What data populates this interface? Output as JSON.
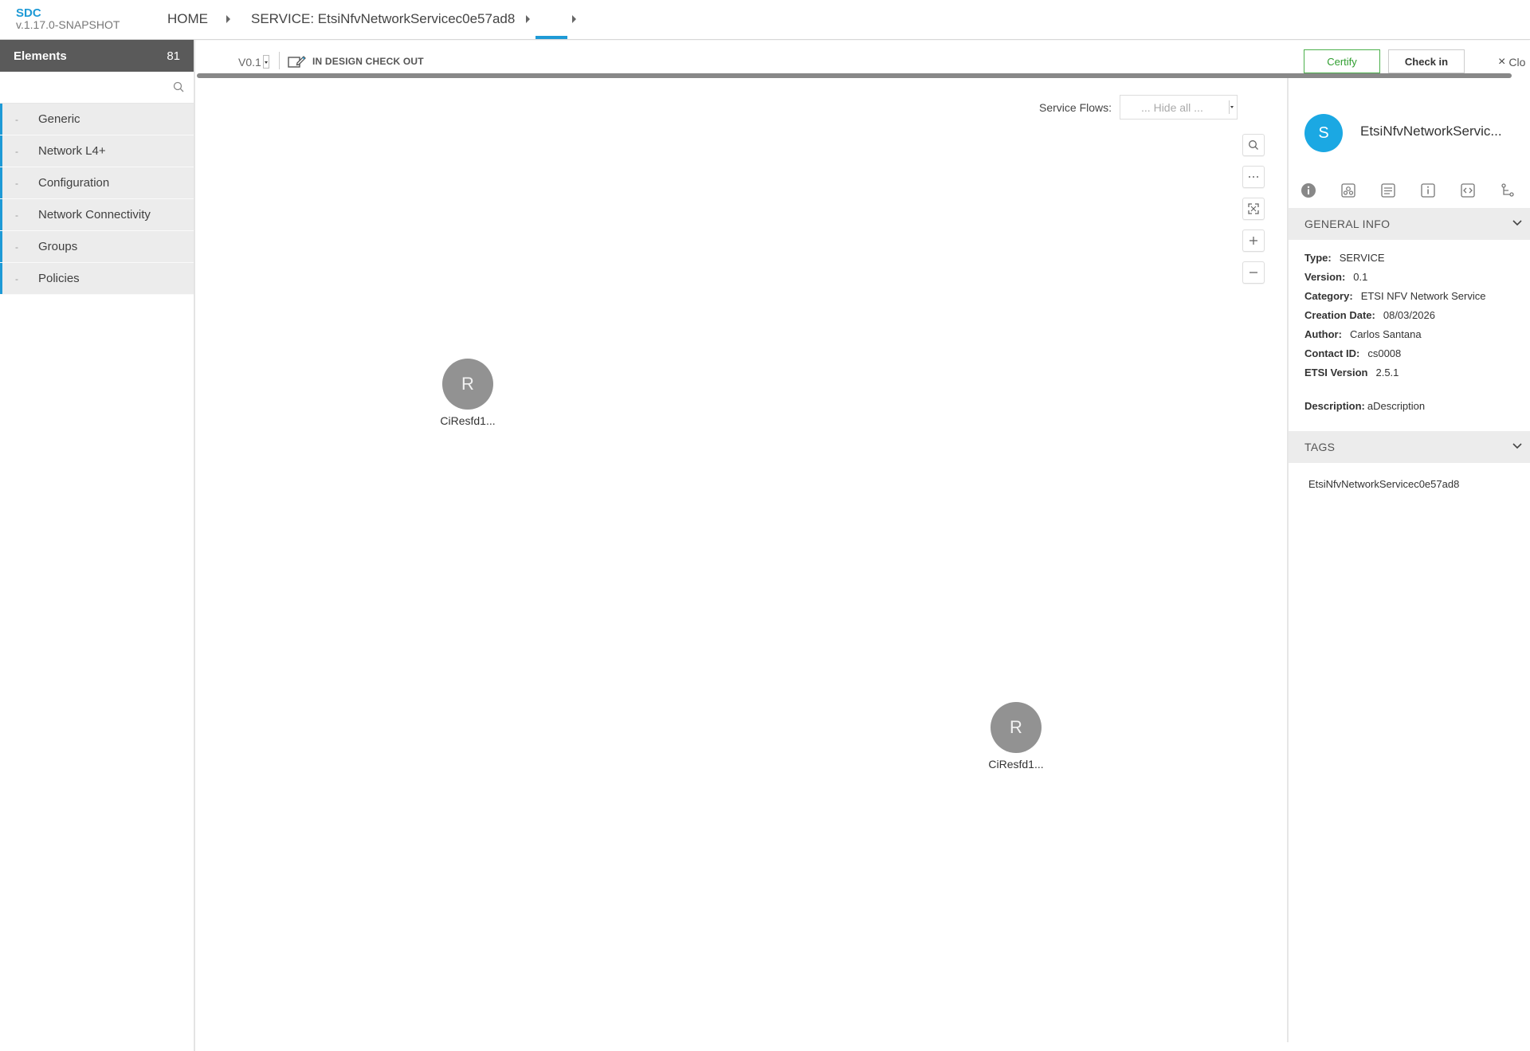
{
  "app": {
    "name": "SDC",
    "version": "v.1.17.0-SNAPSHOT"
  },
  "breadcrumb": {
    "home": "HOME",
    "service": "SERVICE: EtsiNfvNetworkServicec0e57ad8"
  },
  "palette": {
    "header_label": "Elements",
    "header_count": "81",
    "search_placeholder": "",
    "items": [
      {
        "label": "Generic"
      },
      {
        "label": "Network L4+"
      },
      {
        "label": "Configuration"
      },
      {
        "label": "Network Connectivity"
      },
      {
        "label": "Groups"
      },
      {
        "label": "Policies"
      }
    ]
  },
  "toolbar": {
    "version": "V0.1",
    "status": "IN DESIGN CHECK OUT",
    "certify_label": "Certify",
    "checkin_label": "Check in",
    "close_label": "Clo"
  },
  "canvas": {
    "service_flows_label": "Service Flows:",
    "service_flows_value": "... Hide all ...",
    "nodes": [
      {
        "letter": "R",
        "name": "CiResfd1..."
      },
      {
        "letter": "R",
        "name": "CiResfd1..."
      }
    ]
  },
  "details": {
    "avatar_letter": "S",
    "title": "EtsiNfvNetworkServic...",
    "general_info_header": "GENERAL INFO",
    "type_label": "Type:",
    "type_value": "SERVICE",
    "version_label": "Version:",
    "version_value": "0.1",
    "category_label": "Category:",
    "category_value": "ETSI NFV Network Service",
    "creation_label": "Creation Date:",
    "creation_value": "08/03/2026",
    "author_label": "Author:",
    "author_value": "Carlos Santana",
    "contact_label": "Contact ID:",
    "contact_value": "cs0008",
    "etsi_label": "ETSI Version",
    "etsi_value": "2.5.1",
    "description_label": "Description:",
    "description_value": "aDescription",
    "tags_header": "TAGS",
    "tags": [
      "EtsiNfvNetworkServicec0e57ad8"
    ]
  },
  "colors": {
    "accent": "#1e9ad6",
    "certify": "#2f9e2f",
    "node": "#929292",
    "avatar": "#1ba8e3"
  }
}
